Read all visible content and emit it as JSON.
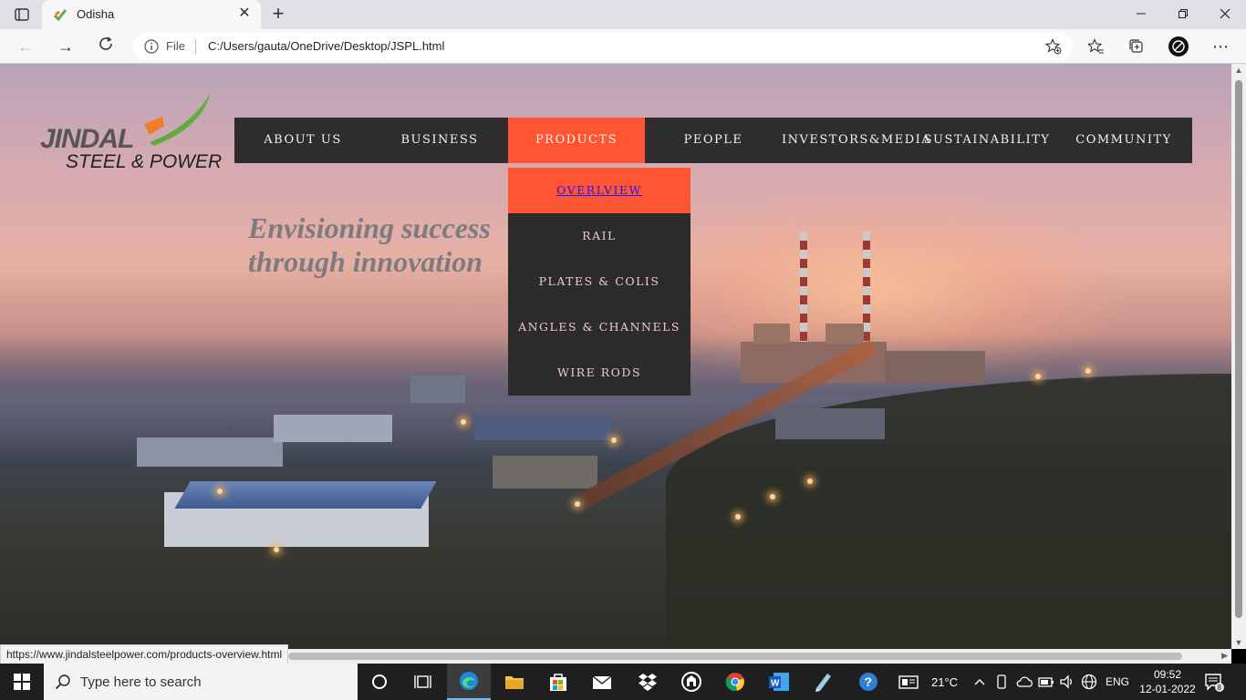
{
  "browser": {
    "tab_title": "Odisha",
    "tab_close": "✕",
    "new_tab": "+",
    "address_scheme": "File",
    "address_url": "C:/Users/gauta/OneDrive/Desktop/JSPL.html",
    "status_url": "https://www.jindalsteelpower.com/products-overview.html"
  },
  "site": {
    "logo_text_top": "JINDAL",
    "logo_text_bottom": "STEEL & POWER",
    "nav": [
      "ABOUT US",
      "BUSINESS",
      "PRODUCTS",
      "PEOPLE",
      "INVESTORS&MEDIA",
      "SUSTAINABILITY",
      "COMMUNITY"
    ],
    "active_nav": "PRODUCTS",
    "dropdown": [
      "OVERLVIEW",
      "RAIL",
      "PLATES & COLIS",
      "ANGLES & CHANNELS",
      "WIRE RODS"
    ],
    "active_dropdown": "OVERLVIEW",
    "tagline_line1": "Envisioning success",
    "tagline_line2": "through innovation",
    "accent_color": "#ff5533",
    "nav_bg_color": "#2d2d2d"
  },
  "taskbar": {
    "search_placeholder": "Type here to search",
    "temperature": "21°C",
    "language": "ENG",
    "time": "09:52",
    "date": "12-01-2022",
    "notification_count": "8"
  }
}
